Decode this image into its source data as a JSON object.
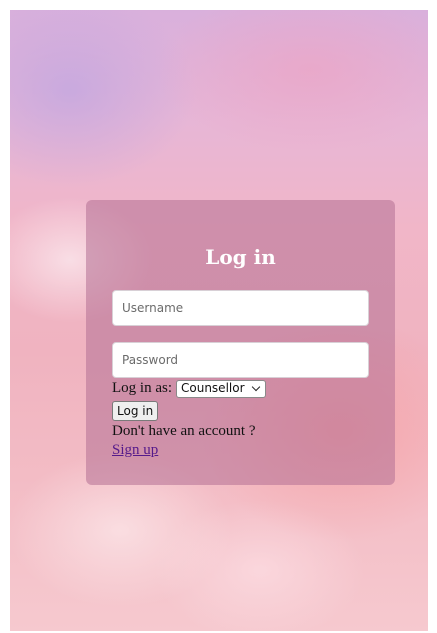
{
  "login_card": {
    "title": "Log in",
    "username": {
      "value": "",
      "placeholder": "Username"
    },
    "password": {
      "value": "",
      "placeholder": "Password"
    },
    "role_label": "Log in as:",
    "role_selected": "Counsellor",
    "submit_label": "Log in",
    "no_account_text": "Don't have an account ?",
    "signup_link": "Sign up"
  },
  "colors": {
    "card_overlay": "#b27094",
    "title_text": "#ffffff",
    "link": "#551a8b",
    "background_top": "#d9b0dc",
    "background_bottom": "#f6c9cf"
  }
}
